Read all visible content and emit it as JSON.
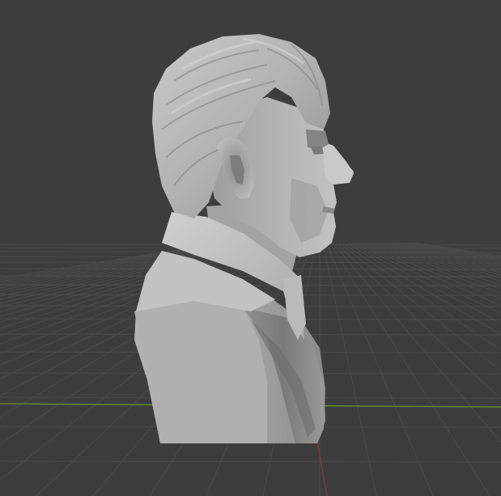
{
  "app": {
    "name": "3D viewport"
  },
  "viewport": {
    "background_color": "#3d3d3d",
    "grid_color": "#4a4a4a",
    "grid_line_color_fine": "#434343",
    "x_axis_color": "#7a9a3a",
    "y_axis_color": "#9a3a3a",
    "model_base_color": "#a6a6a6",
    "model_highlight_color": "#cfcfcf",
    "model_shadow_color": "#6e6e6e"
  },
  "scene": {
    "object": "bust-sculpt",
    "grid_visible": true,
    "axes_visible": [
      "x",
      "y"
    ]
  }
}
